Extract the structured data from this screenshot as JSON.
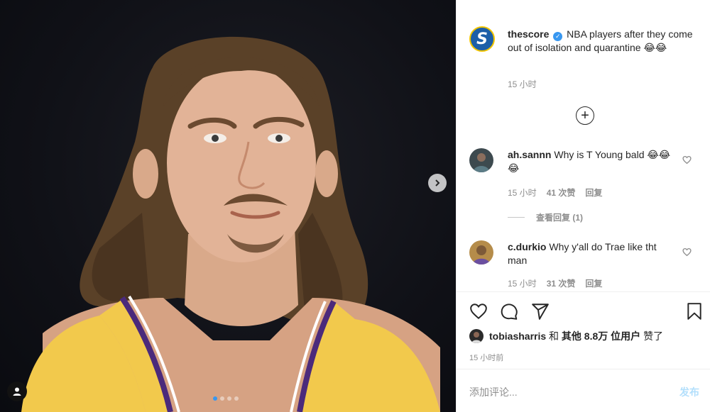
{
  "post": {
    "author": "thescore",
    "caption": "NBA players after they come out of isolation and quarantine",
    "caption_emoji": "😂😂",
    "time": "15 小时"
  },
  "comments": [
    {
      "username": "ah.sannn",
      "text": "Why is T Young bald 😂😂😂",
      "time": "15 小时",
      "likes": "41 次赞",
      "reply": "回复",
      "view_replies": "查看回复 (1)"
    },
    {
      "username": "c.durkio",
      "text": "Why y'all do Trae like tht man",
      "time": "15 小时",
      "likes": "31 次赞",
      "reply": "回复"
    }
  ],
  "likes_line": {
    "user": "tobiasharris",
    "and": "和",
    "others": "其他 8.8万 位用户",
    "liked": "赞了"
  },
  "post_time": "15 小时前",
  "add_comment_placeholder": "添加评论...",
  "publish_label": "发布",
  "icons": {
    "verified": "verified-badge-icon",
    "load_more": "plus-circle-icon",
    "like": "heart-icon",
    "comment": "comment-icon",
    "share": "paper-plane-icon",
    "save": "bookmark-icon",
    "next": "chevron-right-icon",
    "tag": "user-tag-icon"
  },
  "carousel": {
    "count": 4,
    "active": 1
  },
  "colors": {
    "accent": "#3897f0",
    "jersey": "#f2c94c",
    "trim": "#4b2a7b"
  }
}
